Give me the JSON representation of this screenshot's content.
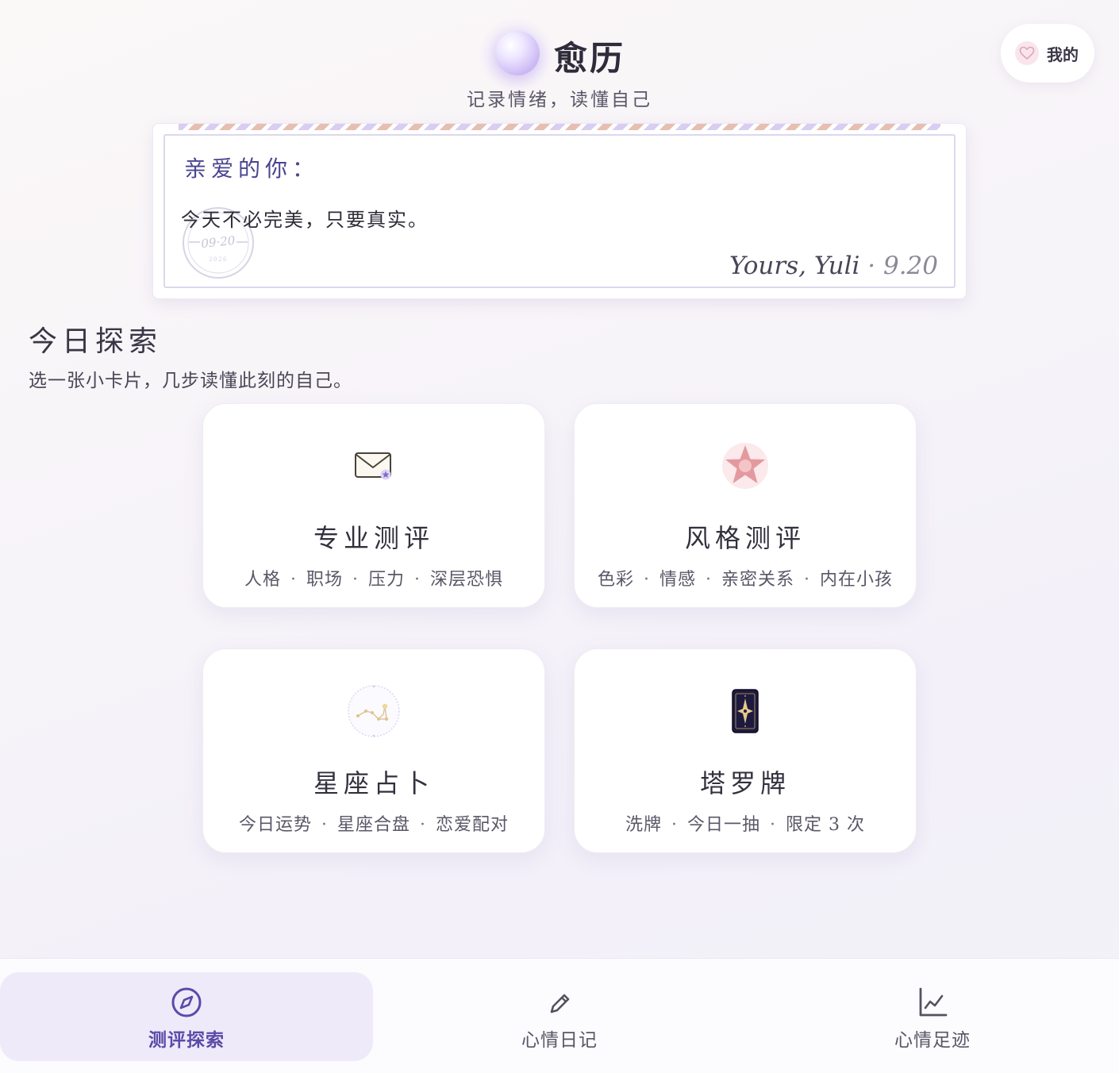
{
  "header": {
    "title": "愈历",
    "subtitle": "记录情绪，读懂自己",
    "me_label": "我的",
    "me_icon": "heart-icon"
  },
  "letter": {
    "salutation": "亲爱的你：",
    "body": "今天不必完美，只要真实。",
    "postmark_date": "09·20",
    "postmark_year": "2026",
    "signature": "Yours, Yuli",
    "signature_date": " · 9.20"
  },
  "section": {
    "title": "今日探索",
    "subtitle": "选一张小卡片，几步读懂此刻的自己。"
  },
  "cards": [
    {
      "title": "专业测评",
      "icon": "envelope-icon",
      "tags": [
        "人格",
        "职场",
        "压力",
        "深层恐惧"
      ]
    },
    {
      "title": "风格测评",
      "icon": "star-icon",
      "tags": [
        "色彩",
        "情感",
        "亲密关系",
        "内在小孩"
      ]
    },
    {
      "title": "星座占卜",
      "icon": "constellation-icon",
      "tags": [
        "今日运势",
        "星座合盘",
        "恋爱配对"
      ]
    },
    {
      "title": "塔罗牌",
      "icon": "tarot-card-icon",
      "tags": [
        "洗牌",
        "今日一抽",
        "限定 3 次"
      ]
    }
  ],
  "nav": [
    {
      "label": "测评探索",
      "icon": "compass-icon",
      "active": true
    },
    {
      "label": "心情日记",
      "icon": "pencil-icon",
      "active": false
    },
    {
      "label": "心情足迹",
      "icon": "line-chart-icon",
      "active": false
    }
  ],
  "colors": {
    "accent": "#5b4aa8",
    "nav_active_bg": "#efeafa",
    "star_pink": "#e39a9e",
    "tarot_navy": "#1e1a3e"
  }
}
